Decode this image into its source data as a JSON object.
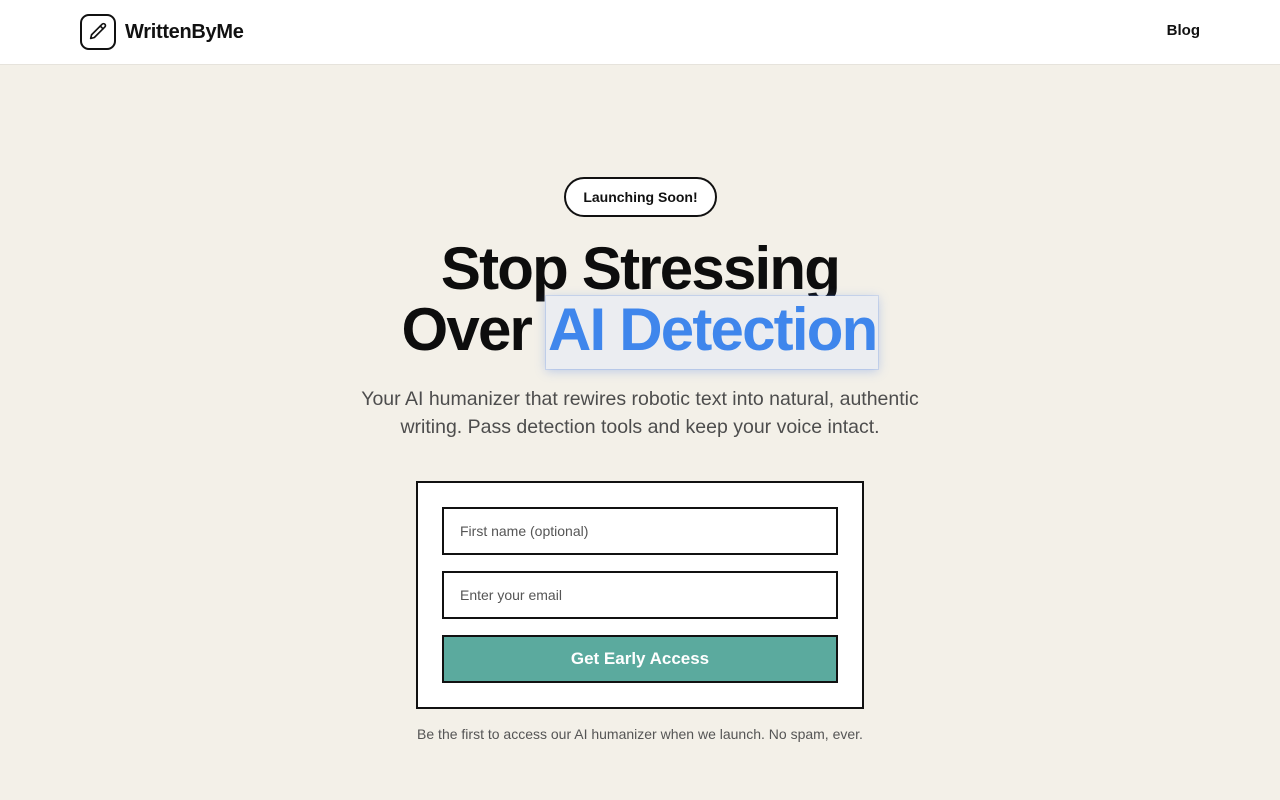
{
  "header": {
    "brand_name": "WrittenByMe",
    "brand_icon": "pencil-icon",
    "nav": {
      "blog_label": "Blog"
    }
  },
  "hero": {
    "badge": "Launching Soon!",
    "title_line1": "Stop Stressing",
    "title_line2_prefix": "Over",
    "title_line2_highlight": "AI Detection",
    "subtitle": "Your AI humanizer that rewires robotic text into natural, authentic writing. Pass detection tools and keep your voice intact."
  },
  "form": {
    "name_placeholder": "First name (optional)",
    "name_value": "",
    "email_placeholder": "Enter your email",
    "email_value": "",
    "submit_label": "Get Early Access"
  },
  "footnote": "Be the first to access our AI humanizer when we launch. No spam, ever.",
  "colors": {
    "background": "#f3f0e8",
    "accent_blue": "#3f86ec",
    "button_teal": "#5baa9e",
    "text_dark": "#111111"
  }
}
